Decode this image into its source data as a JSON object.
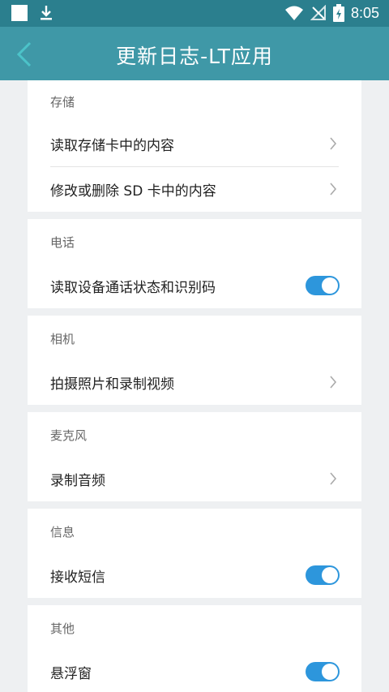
{
  "status_bar": {
    "time": "8:05"
  },
  "app_bar": {
    "title": "更新日志-LT应用"
  },
  "sections": [
    {
      "title": "存储",
      "items": [
        {
          "label": "读取存储卡中的内容",
          "control": "chevron"
        },
        {
          "label": "修改或删除 SD 卡中的内容",
          "control": "chevron"
        }
      ]
    },
    {
      "title": "电话",
      "items": [
        {
          "label": "读取设备通话状态和识别码",
          "control": "toggle",
          "on": true
        }
      ]
    },
    {
      "title": "相机",
      "items": [
        {
          "label": "拍摄照片和录制视频",
          "control": "chevron"
        }
      ]
    },
    {
      "title": "麦克风",
      "items": [
        {
          "label": "录制音频",
          "control": "chevron"
        }
      ]
    },
    {
      "title": "信息",
      "items": [
        {
          "label": "接收短信",
          "control": "toggle",
          "on": true
        }
      ]
    },
    {
      "title": "其他",
      "items": [
        {
          "label": "悬浮窗",
          "control": "toggle",
          "on": true
        }
      ]
    }
  ],
  "colors": {
    "status_bar": "#2b7f8e",
    "app_bar": "#3f98a7",
    "toggle_on": "#2d96dc",
    "back_arrow": "#4cc3c9"
  }
}
